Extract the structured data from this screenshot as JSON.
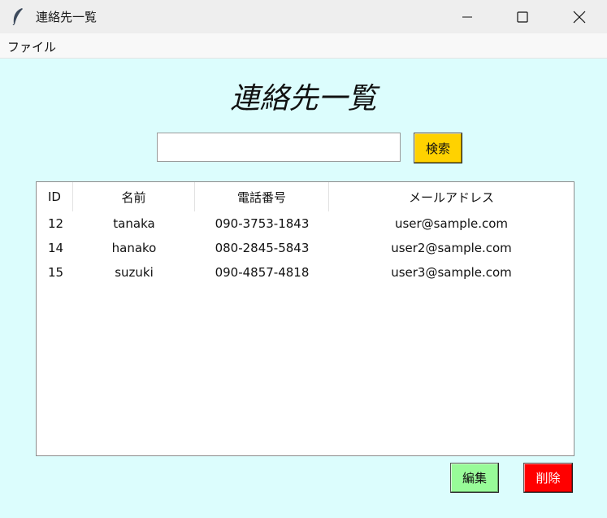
{
  "window": {
    "title": "連絡先一覧",
    "icon": "feather-icon",
    "controls": [
      "minimize-icon",
      "maximize-icon",
      "close-icon"
    ]
  },
  "menubar": {
    "file_label": "ファイル"
  },
  "main": {
    "heading": "連絡先一覧",
    "search": {
      "value": "",
      "placeholder": "",
      "button_label": "検索"
    },
    "table": {
      "columns": [
        "ID",
        "名前",
        "電話番号",
        "メールアドレス"
      ],
      "rows": [
        [
          "12",
          "tanaka",
          "090-3753-1843",
          "user@sample.com"
        ],
        [
          "14",
          "hanako",
          "080-2845-5843",
          "user2@sample.com"
        ],
        [
          "15",
          "suzuki",
          "090-4857-4818",
          "user3@sample.com"
        ]
      ]
    },
    "actions": {
      "edit_label": "編集",
      "delete_label": "削除"
    }
  },
  "colors": {
    "background": "#dcfdfd",
    "search_button": "#ffd200",
    "edit_button": "#98fb98",
    "delete_button": "#ff0000"
  }
}
